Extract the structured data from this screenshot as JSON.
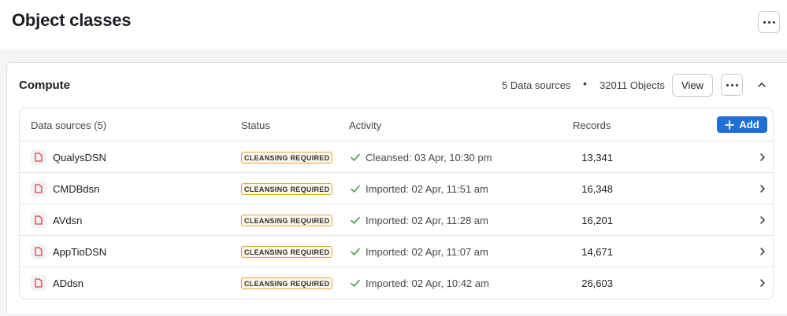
{
  "page": {
    "title": "Object classes"
  },
  "card": {
    "title": "Compute",
    "data_sources_count": "5 Data sources",
    "separator": "•",
    "objects_count": "32011 Objects",
    "view_label": "View"
  },
  "table": {
    "headers": {
      "sources": "Data sources (5)",
      "status": "Status",
      "activity": "Activity",
      "records": "Records"
    },
    "add_label": "Add",
    "rows": [
      {
        "name": "QualysDSN",
        "status": "CLEANSING REQUIRED",
        "activity": "Cleansed: 03 Apr, 10:30 pm",
        "records": "13,341"
      },
      {
        "name": "CMDBdsn",
        "status": "CLEANSING REQUIRED",
        "activity": "Imported: 02 Apr, 11:51 am",
        "records": "16,348"
      },
      {
        "name": "AVdsn",
        "status": "CLEANSING REQUIRED",
        "activity": "Imported: 02 Apr, 11:28 am",
        "records": "16,201"
      },
      {
        "name": "AppTioDSN",
        "status": "CLEANSING REQUIRED",
        "activity": "Imported: 02 Apr, 11:07 am",
        "records": "14,671"
      },
      {
        "name": "ADdsn",
        "status": "CLEANSING REQUIRED",
        "activity": "Imported: 02 Apr, 10:42 am",
        "records": "26,603"
      }
    ]
  },
  "colors": {
    "accent": "#1f6fd6",
    "badge_border": "#e3a33a",
    "check": "#3a9a3a",
    "file_icon": "#d64545"
  }
}
